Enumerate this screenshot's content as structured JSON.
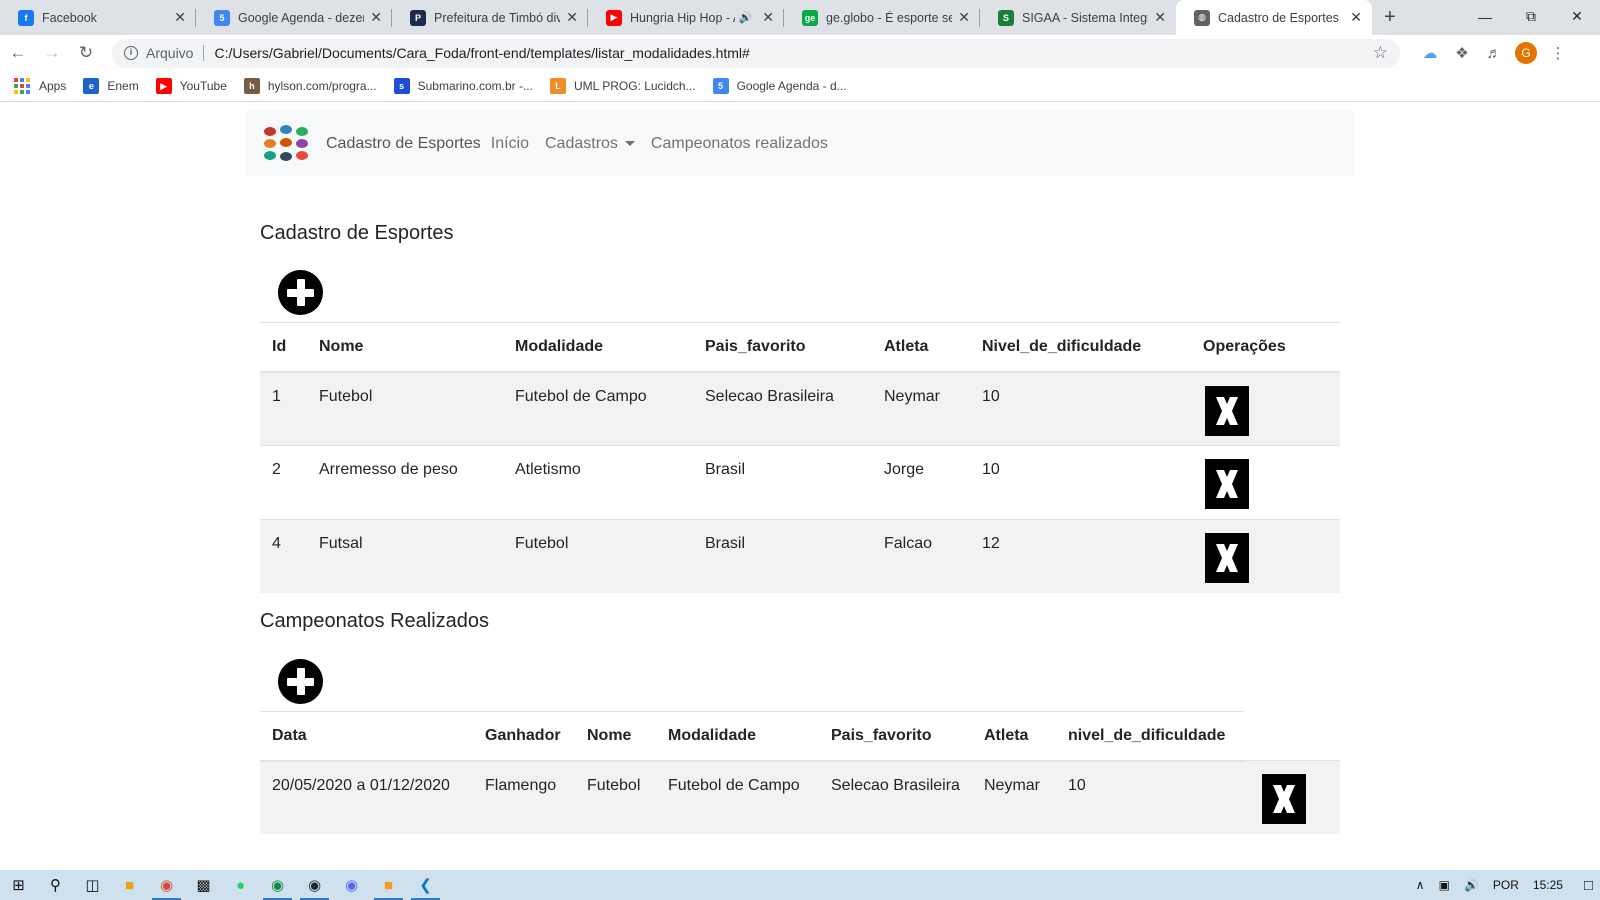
{
  "browser": {
    "tabs": [
      {
        "title": "Facebook",
        "favicon": "facebook-icon",
        "color": "#1877f2",
        "glyph": "f"
      },
      {
        "title": "Google Agenda - dezem",
        "favicon": "google-calendar-icon",
        "color": "#4285f4",
        "glyph": "5"
      },
      {
        "title": "Prefeitura de Timbó divu",
        "favicon": "prefeitura-icon",
        "color": "#1c2b4a",
        "glyph": "P"
      },
      {
        "title": "Hungria Hip Hop - A",
        "favicon": "youtube-icon",
        "color": "#ff0000",
        "glyph": "▶",
        "audio": "🔊"
      },
      {
        "title": "ge.globo - É esporte sem",
        "favicon": "ge-globo-icon",
        "color": "#06aa48",
        "glyph": "ge"
      },
      {
        "title": "SIGAA - Sistema Integrac",
        "favicon": "sigaa-icon",
        "color": "#1a7f37",
        "glyph": "S"
      },
      {
        "title": "Cadastro de Esportes",
        "favicon": "globe-icon",
        "color": "#5f6368",
        "glyph": "◍",
        "active": true
      }
    ],
    "address": {
      "scheme": "Arquivo",
      "url": "C:/Users/Gabriel/Documents/Cara_Foda/front-end/templates/listar_modalidades.html#"
    },
    "profile_initial": "G",
    "bookmarks": [
      {
        "label": "Apps",
        "icon": "apps-grid-icon"
      },
      {
        "label": "Enem",
        "icon": "enem-icon",
        "color": "#1c64c8",
        "glyph": "e"
      },
      {
        "label": "YouTube",
        "icon": "youtube-icon",
        "color": "#ff0000",
        "glyph": "▶"
      },
      {
        "label": "hylson.com/progra...",
        "icon": "hylson-icon",
        "color": "#7a5c45",
        "glyph": "h"
      },
      {
        "label": "Submarino.com.br -...",
        "icon": "submarino-icon",
        "color": "#1c4fd6",
        "glyph": "s"
      },
      {
        "label": "UML PROG: Lucidch...",
        "icon": "lucidchart-icon",
        "color": "#f28c28",
        "glyph": "L"
      },
      {
        "label": "Google Agenda - d...",
        "icon": "google-calendar-icon",
        "color": "#4285f4",
        "glyph": "5"
      }
    ]
  },
  "navbar": {
    "brand": "Cadastro de Esportes",
    "links": [
      "Início",
      "Cadastros",
      "Campeonatos realizados"
    ]
  },
  "esportes": {
    "title": "Cadastro de Esportes",
    "headers": [
      "Id",
      "Nome",
      "Modalidade",
      "Pais_favorito",
      "Atleta",
      "Nivel_de_dificuldade",
      "Operações"
    ],
    "rows": [
      [
        "1",
        "Futebol",
        "Futebol de Campo",
        "Selecao Brasileira",
        "Neymar",
        "10"
      ],
      [
        "2",
        "Arremesso de peso",
        "Atletismo",
        "Brasil",
        "Jorge",
        "10"
      ],
      [
        "4",
        "Futsal",
        "Futebol",
        "Brasil",
        "Falcao",
        "12"
      ]
    ]
  },
  "campeonatos": {
    "title": "Campeonatos Realizados",
    "headers": [
      "Data",
      "Ganhador",
      "Nome",
      "Modalidade",
      "Pais_favorito",
      "Atleta",
      "nivel_de_dificuldade"
    ],
    "rows": [
      [
        "20/05/2020 a 01/12/2020",
        "Flamengo",
        "Futebol",
        "Futebol de Campo",
        "Selecao Brasileira",
        "Neymar",
        "10"
      ]
    ]
  },
  "taskbar": {
    "lang": "POR",
    "time": "15:25"
  }
}
